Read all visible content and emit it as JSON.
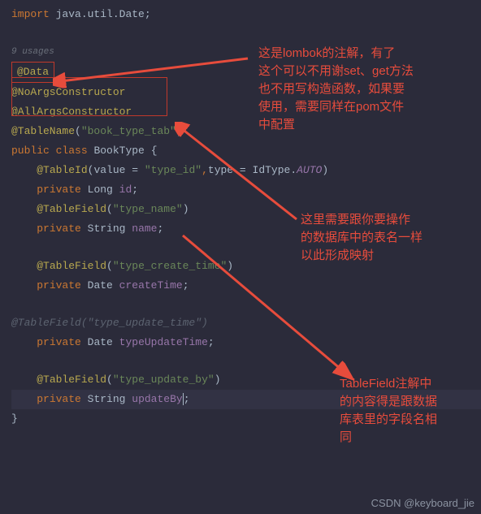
{
  "code": {
    "import_kw": "import",
    "import_pkg": "java.util.Date",
    "import_semi": ";",
    "usages": "9 usages",
    "anno_data": "@Data",
    "anno_noargs": "@NoArgsConstructor",
    "anno_allargs": "@AllArgsConstructor",
    "anno_tablename": "@TableName",
    "str_tablename": "\"book_type_tab\"",
    "kw_public": "public",
    "kw_class": "class",
    "class_name": "BookType",
    "brace_open": "{",
    "anno_tableid": "@TableId",
    "tableid_value_key": "value = ",
    "tableid_value_str": "\"type_id\"",
    "tableid_type_key": "type = ",
    "tableid_type_val": "IdType",
    "tableid_auto": "AUTO",
    "kw_private": "private",
    "type_long": "Long",
    "field_id": "id",
    "anno_tablefield": "@TableField",
    "str_typename": "\"type_name\"",
    "type_string": "String",
    "field_name": "name",
    "str_createtime": "\"type_create_time\"",
    "type_date": "Date",
    "field_createtime": "createTime",
    "str_updatetime_gray": "@TableField(\"type_update_time\")",
    "field_updatetime": "typeUpdateTime",
    "str_updateby": "\"type_update_by\"",
    "field_updateby": "updateBy",
    "brace_close": "}",
    "semi": ";",
    "dot": ".",
    "comma": ","
  },
  "annotations": {
    "a1_l1": "这是lombok的注解，有了",
    "a1_l2": "这个可以不用谢set、get方法",
    "a1_l3": "也不用写构造函数，如果要",
    "a1_l4": "使用，需要同样在pom文件",
    "a1_l5": "中配置",
    "a2_l1": "这里需要跟你要操作",
    "a2_l2": "的数据库中的表名一样",
    "a2_l3": "以此形成映射",
    "a3_l1": "TableField注解中",
    "a3_l2": "的内容得是跟数据",
    "a3_l3": "库表里的字段名相",
    "a3_l4": "同"
  },
  "watermark": "CSDN @keyboard_jie"
}
